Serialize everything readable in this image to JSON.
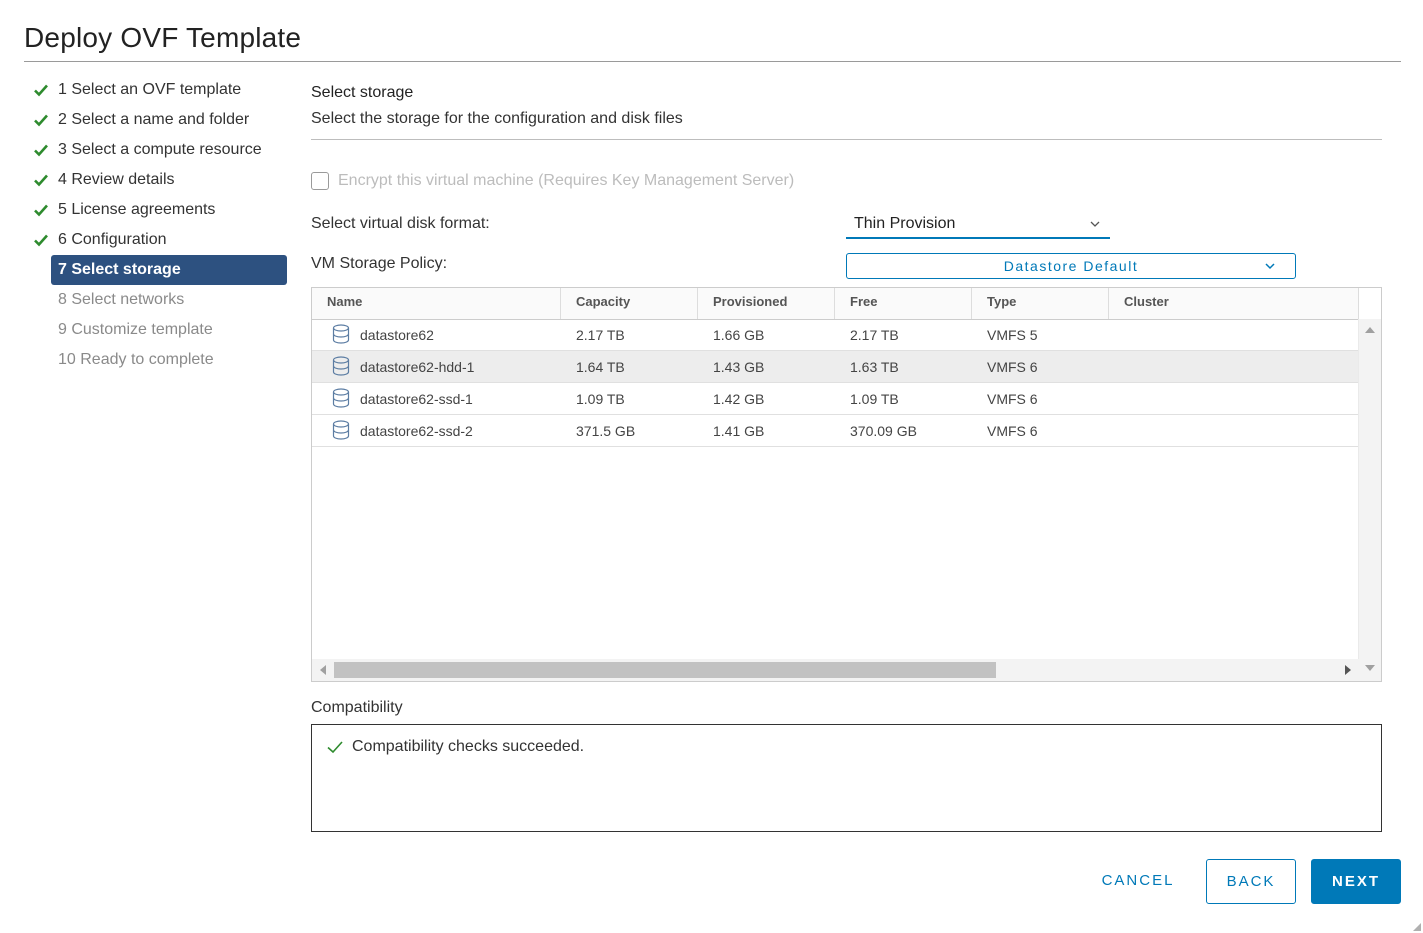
{
  "window": {
    "title": "Deploy OVF Template"
  },
  "steps": [
    {
      "label": "1 Select an OVF template",
      "state": "done"
    },
    {
      "label": "2 Select a name and folder",
      "state": "done"
    },
    {
      "label": "3 Select a compute resource",
      "state": "done"
    },
    {
      "label": "4 Review details",
      "state": "done"
    },
    {
      "label": "5 License agreements",
      "state": "done"
    },
    {
      "label": "6 Configuration",
      "state": "done"
    },
    {
      "label": "7 Select storage",
      "state": "active"
    },
    {
      "label": "8 Select networks",
      "state": "pending"
    },
    {
      "label": "9 Customize template",
      "state": "pending"
    },
    {
      "label": "10 Ready to complete",
      "state": "pending"
    }
  ],
  "page": {
    "title": "Select storage",
    "subtitle": "Select the storage for the configuration and disk files"
  },
  "encrypt": {
    "label": "Encrypt this virtual machine (Requires Key Management Server)",
    "checked": false,
    "disabled": true
  },
  "disk_format": {
    "label": "Select virtual disk format:",
    "value": "Thin Provision"
  },
  "storage_policy": {
    "label": "VM Storage Policy:",
    "value": "Datastore Default"
  },
  "table": {
    "columns": [
      "Name",
      "Capacity",
      "Provisioned",
      "Free",
      "Type",
      "Cluster"
    ],
    "rows": [
      {
        "name": "datastore62",
        "capacity": "2.17 TB",
        "provisioned": "1.66 GB",
        "free": "2.17 TB",
        "type": "VMFS 5",
        "cluster": ""
      },
      {
        "name": "datastore62-hdd-1",
        "capacity": "1.64 TB",
        "provisioned": "1.43 GB",
        "free": "1.63 TB",
        "type": "VMFS 6",
        "cluster": ""
      },
      {
        "name": "datastore62-ssd-1",
        "capacity": "1.09 TB",
        "provisioned": "1.42 GB",
        "free": "1.09 TB",
        "type": "VMFS 6",
        "cluster": ""
      },
      {
        "name": "datastore62-ssd-2",
        "capacity": "371.5 GB",
        "provisioned": "1.41 GB",
        "free": "370.09 GB",
        "type": "VMFS 6",
        "cluster": ""
      }
    ],
    "selected_index": 1
  },
  "compatibility": {
    "label": "Compatibility",
    "message": "Compatibility checks succeeded."
  },
  "buttons": {
    "cancel": "CANCEL",
    "back": "BACK",
    "next": "NEXT"
  },
  "colors": {
    "accent": "#0079b8",
    "active_step": "#2d5180",
    "check": "#2e8b2e"
  },
  "icons": {
    "step_done": "check-icon",
    "datastore": "database-icon",
    "dropdown": "chevron-down-icon"
  }
}
